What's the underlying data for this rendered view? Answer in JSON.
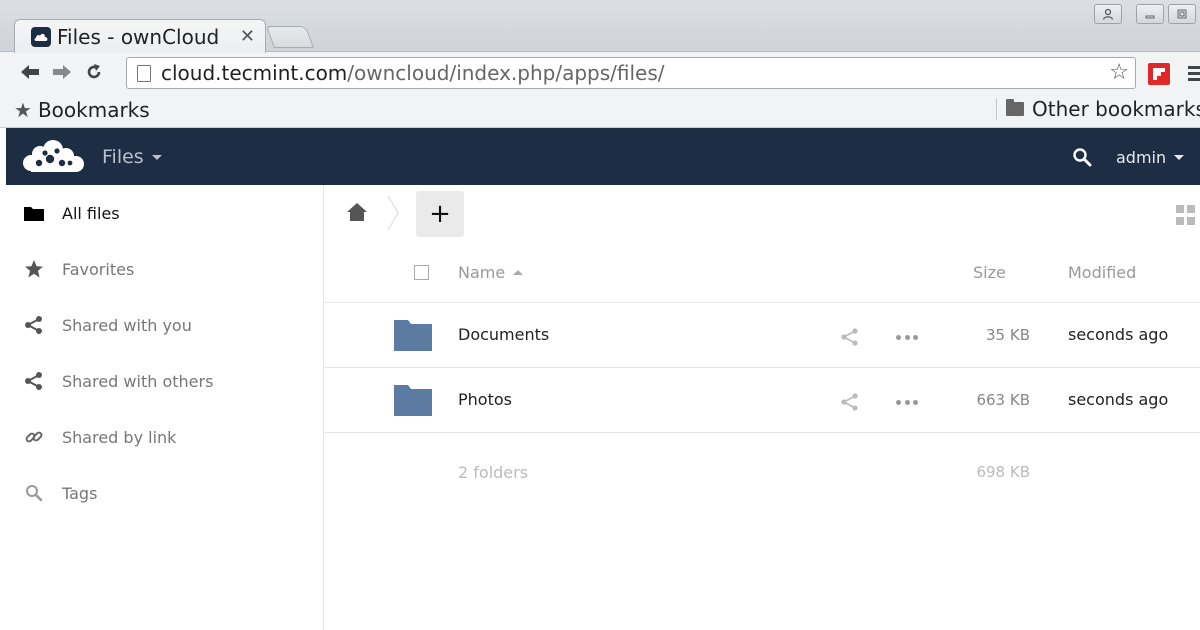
{
  "browser": {
    "tab_title": "Files - ownCloud",
    "tab_close": "✕",
    "url_host": "cloud.tecmint.com",
    "url_path": "/owncloud/index.php/apps/files/",
    "bookmarks_label": "Bookmarks",
    "other_bookmarks_label": "Other bookmarks",
    "window_buttons": [
      "user-icon",
      "minimize-icon",
      "maximize-icon"
    ]
  },
  "header": {
    "app_name": "Files",
    "user_name": "admin",
    "brand_color": "#1d2d44"
  },
  "sidebar": {
    "items": [
      {
        "label": "All files",
        "icon": "folder-icon",
        "active": true
      },
      {
        "label": "Favorites",
        "icon": "star-icon",
        "active": false
      },
      {
        "label": "Shared with you",
        "icon": "share-icon",
        "active": false
      },
      {
        "label": "Shared with others",
        "icon": "share-icon",
        "active": false
      },
      {
        "label": "Shared by link",
        "icon": "link-icon",
        "active": false
      },
      {
        "label": "Tags",
        "icon": "search-icon",
        "active": false
      }
    ]
  },
  "controls": {
    "new_label": "+"
  },
  "table": {
    "headers": {
      "name": "Name",
      "size": "Size",
      "modified": "Modified"
    },
    "rows": [
      {
        "name": "Documents",
        "size": "35 KB",
        "modified": "seconds ago"
      },
      {
        "name": "Photos",
        "size": "663 KB",
        "modified": "seconds ago"
      }
    ],
    "summary": {
      "count": "2 folders",
      "total": "698 KB"
    },
    "folder_color": "#5b7ba3"
  }
}
